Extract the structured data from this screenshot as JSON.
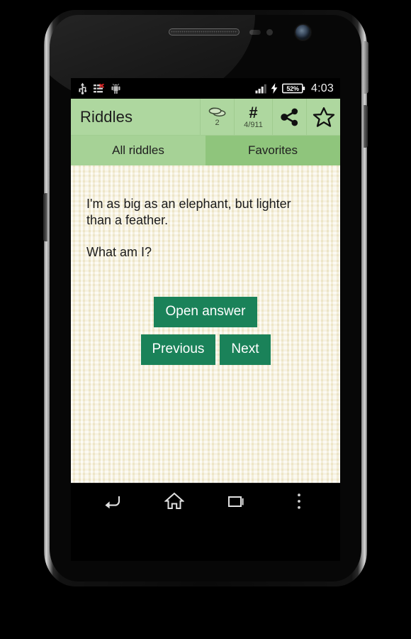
{
  "device": {
    "name": "android-phone-mock",
    "hardware": {
      "speaker": "earpiece-speaker",
      "front_camera": "front-camera",
      "power_button": "power-button",
      "volume_button": "volume-button"
    }
  },
  "status_bar": {
    "left_icons": [
      {
        "name": "usb-icon",
        "label": "USB"
      },
      {
        "name": "list-error-icon",
        "label": "Sync error"
      },
      {
        "name": "android-icon",
        "label": "Android"
      }
    ],
    "signal": {
      "name": "signal-bars-icon",
      "bars_filled": 3,
      "bars_total": 4
    },
    "charging": {
      "name": "charging-bolt-icon",
      "charging": true
    },
    "battery": {
      "name": "battery-icon",
      "percent_label": "52%",
      "percent": 52
    },
    "time": "4:03"
  },
  "app_bar": {
    "title": "Riddles",
    "actions": [
      {
        "name": "difficulty-action",
        "icon": "coins-stack-icon",
        "sub_label": "2"
      },
      {
        "name": "riddle-index-action",
        "icon": "hash-icon",
        "glyph": "#",
        "sub_label": "4/911"
      },
      {
        "name": "share-action",
        "icon": "share-icon",
        "sub_label": ""
      },
      {
        "name": "favorite-action",
        "icon": "star-outline-icon",
        "sub_label": ""
      }
    ]
  },
  "tabs": {
    "items": [
      {
        "label": "All riddles",
        "active": true
      },
      {
        "label": "Favorites",
        "active": false
      }
    ]
  },
  "content": {
    "riddle_text": "I'm as big as an elephant, but lighter than a feather.",
    "riddle_question": "What am I?",
    "buttons": {
      "open_answer": "Open answer",
      "previous": "Previous",
      "next": "Next"
    }
  },
  "nav_bar": {
    "buttons": [
      {
        "name": "nav-back-button",
        "icon": "back-arrow-icon"
      },
      {
        "name": "nav-home-button",
        "icon": "home-icon"
      },
      {
        "name": "nav-recents-button",
        "icon": "recents-icon"
      },
      {
        "name": "nav-overflow-button",
        "icon": "overflow-menu-icon"
      }
    ]
  },
  "colors": {
    "app_bar_green": "#aed79f",
    "tab_green": "#8fc57c",
    "tab_active_green": "#a6d296",
    "button_green": "#1a8259",
    "paper_cream": "#f6f0d8",
    "status_bar_black": "#000000"
  }
}
